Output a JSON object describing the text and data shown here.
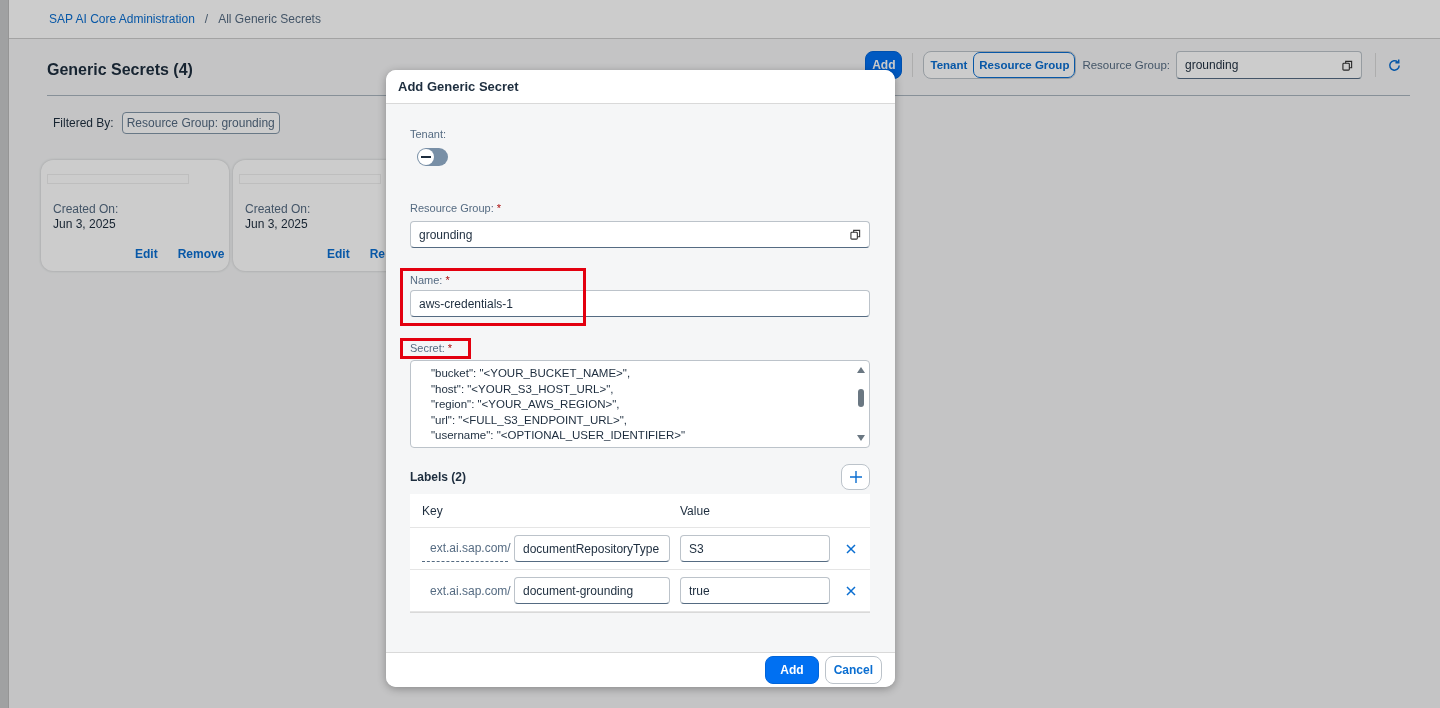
{
  "breadcrumb": {
    "separator": "/",
    "items": [
      {
        "label": "SAP AI Core Administration",
        "kind": "link"
      },
      {
        "label": "All Generic Secrets",
        "kind": "current"
      }
    ]
  },
  "page": {
    "title": "Generic Secrets (4)",
    "add_button": "Add",
    "scope_tabs": [
      {
        "label": "Tenant",
        "selected": false
      },
      {
        "label": "Resource Group",
        "selected": true
      }
    ],
    "resource_group_label": "Resource Group:",
    "resource_group_value": "grounding"
  },
  "filter": {
    "label": "Filtered By:",
    "token": "Resource Group: grounding"
  },
  "cards": [
    {
      "created_label": "Created On:",
      "created": "Jun 3, 2025",
      "actions": [
        "Edit",
        "Remove"
      ]
    },
    {
      "created_label": "Created On:",
      "created": "Jun 3, 2025",
      "actions": [
        "Edit",
        "Re"
      ]
    }
  ],
  "dialog": {
    "title": "Add Generic Secret",
    "tenant": {
      "label": "Tenant:",
      "on": false
    },
    "resource_group": {
      "label": "Resource Group:",
      "value": "grounding",
      "required_mark": "*"
    },
    "name": {
      "label": "Name:",
      "value": "aws-credentials-1",
      "required_mark": "*"
    },
    "secret": {
      "label": "Secret:",
      "required_mark": "*",
      "lines": [
        "\"bucket\": \"<YOUR_BUCKET_NAME>\",",
        "\"host\": \"<YOUR_S3_HOST_URL>\",",
        "\"region\": \"<YOUR_AWS_REGION>\",",
        "\"url\": \"<FULL_S3_ENDPOINT_URL>\",",
        "\"username\": \"<OPTIONAL_USER_IDENTIFIER>\""
      ]
    },
    "labels": {
      "title": "Labels (2)",
      "key_header": "Key",
      "value_header": "Value",
      "rows": [
        {
          "prefix": "ext.ai.sap.com/",
          "key": "documentRepositoryType",
          "value": "S3"
        },
        {
          "prefix": "ext.ai.sap.com/",
          "key": "document-grounding",
          "value": "true"
        }
      ]
    },
    "buttons": [
      {
        "label": "Add",
        "kind": "primary"
      },
      {
        "label": "Cancel",
        "kind": "secondary"
      }
    ]
  }
}
